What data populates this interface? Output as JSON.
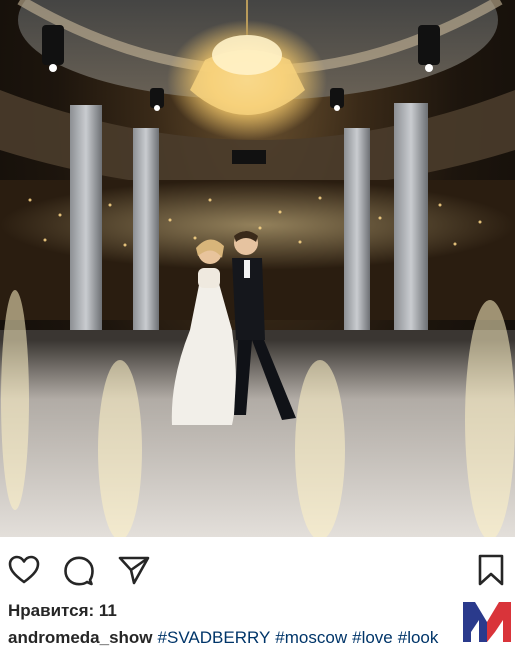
{
  "post": {
    "photo_alt": "",
    "likes_label": "Нравится: 11",
    "caption": {
      "username": "andromeda_show",
      "hashtags": [
        "#SVADBERRY",
        "#moscow",
        "#love",
        "#look"
      ]
    }
  },
  "icons": {
    "like": "heart-icon",
    "comment": "comment-bubble-icon",
    "share": "paper-plane-icon",
    "save": "bookmark-icon",
    "watermark": "m-logo-icon"
  },
  "colors": {
    "text": "#262626",
    "hashtag": "#003569",
    "logo_left": "#2a3a8c",
    "logo_right": "#d9343a"
  }
}
